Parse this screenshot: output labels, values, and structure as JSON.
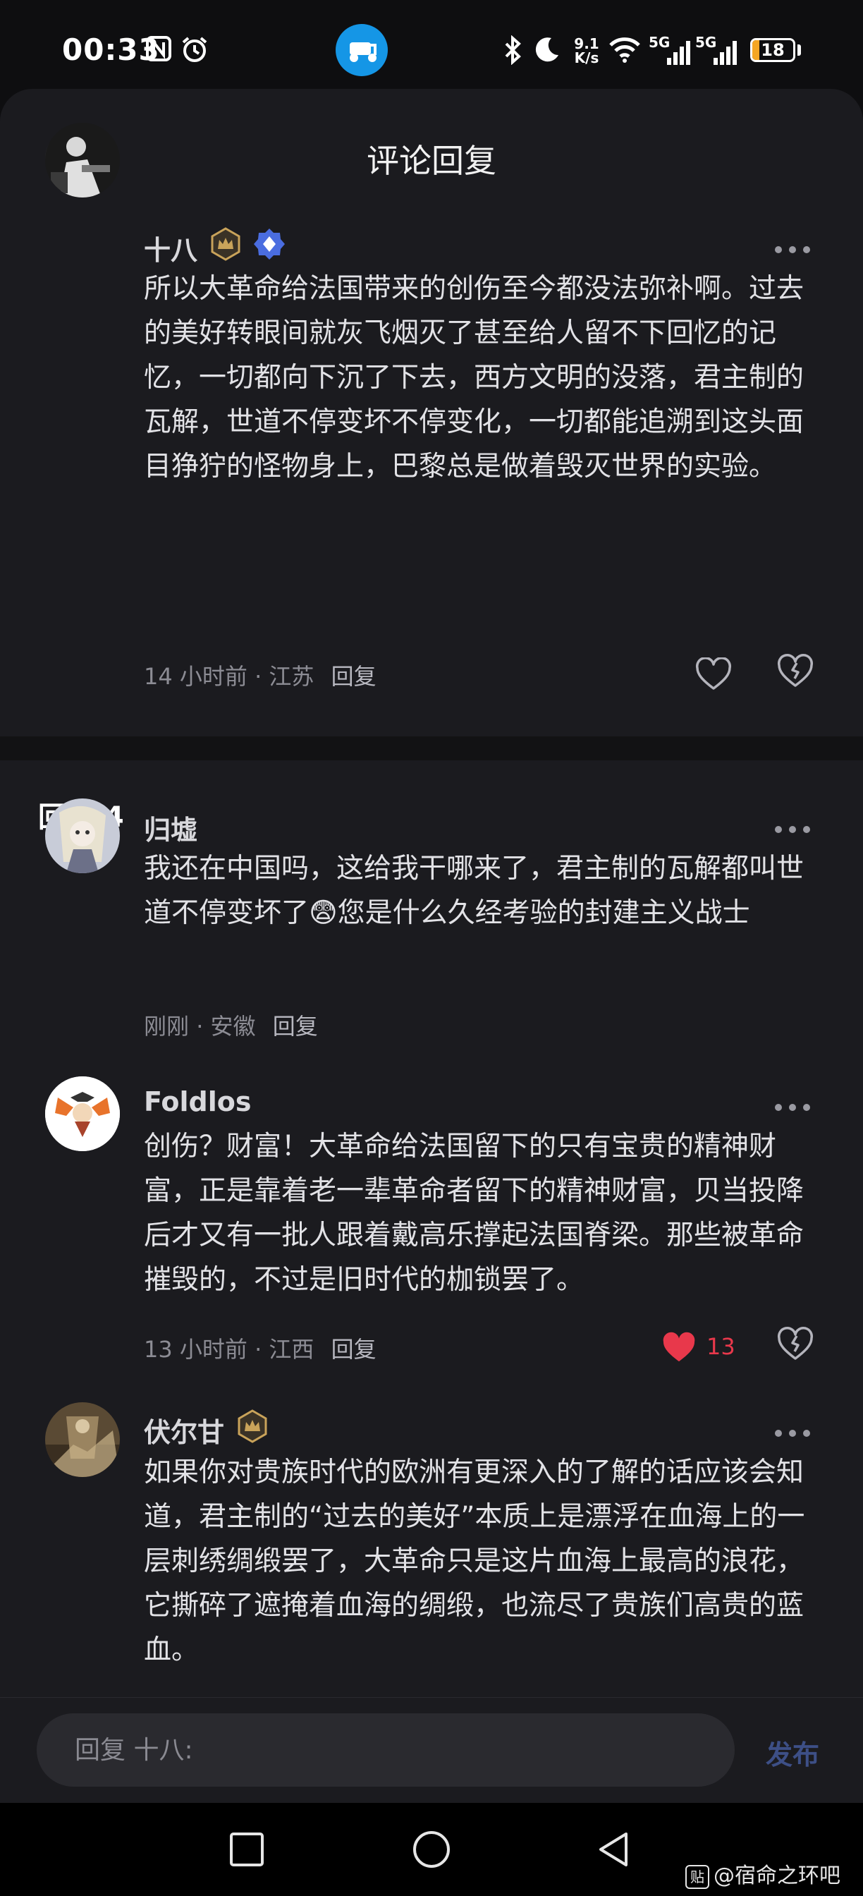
{
  "status_bar": {
    "time": "00:33",
    "net_speed_value": "9.1",
    "net_speed_unit": "K/s",
    "sim1": "5G",
    "sim2": "5G",
    "battery": "18",
    "battery_level": 0.18
  },
  "header": {
    "title": "评论回复"
  },
  "main_comment": {
    "username": "十八",
    "text": "所以大革命给法国带来的创伤至今都没法弥补啊。过去的美好转眼间就灰飞烟灭了甚至给人留不下回忆的记忆，一切都向下沉了下去，西方文明的没落，君主制的瓦解，世道不停变坏不停变化，一切都能追溯到这头面目狰狞的怪物身上，巴黎总是做着毁灭世界的实验。",
    "time": "14 小时前",
    "location": "江苏",
    "reply_label": "回复"
  },
  "replies": {
    "title": "回复 4",
    "items": [
      {
        "username": "归墟",
        "text": "我还在中国吗，这给我干哪来了，君主制的瓦解都叫世道不停变坏了😨您是什么久经考验的封建主义战士",
        "time": "刚刚",
        "location": "安徽",
        "reply_label": "回复"
      },
      {
        "username": "Foldlos",
        "text": "创伤？财富！大革命给法国留下的只有宝贵的精神财富，正是靠着老一辈革命者留下的精神财富，贝当投降后才又有一批人跟着戴高乐撑起法国脊梁。那些被革命摧毁的，不过是旧时代的枷锁罢了。",
        "time": "13 小时前",
        "location": "江西",
        "reply_label": "回复",
        "likes": "13"
      },
      {
        "username": "伏尔甘",
        "text": "如果你对贵族时代的欧洲有更深入的了解的话应该会知道，君主制的“过去的美好”本质上是漂浮在血海上的一层刺绣绸缎罢了，大革命只是这片血海上最高的浪花，它撕碎了遮掩着血海的绸缎，也流尽了贵族们高贵的蓝血。"
      }
    ]
  },
  "input": {
    "placeholder": "回复 十八:",
    "publish_label": "发布"
  },
  "watermark": {
    "box": "贴",
    "text": "@宿命之环吧"
  },
  "colors": {
    "liked": "#e8384b",
    "publish": "#3d4f86",
    "badge_gold": "#c9a35a",
    "badge_blue": "#4a6de0"
  }
}
